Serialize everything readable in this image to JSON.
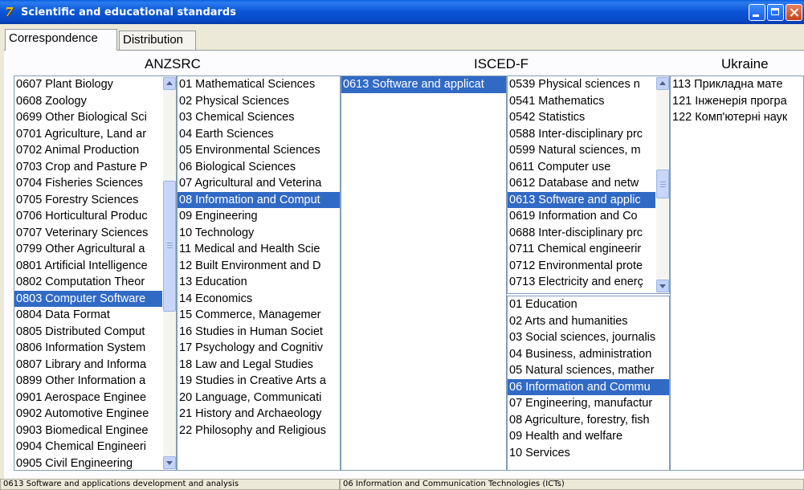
{
  "window": {
    "title": "Scientific and educational standards",
    "icon": "app-logo-icon"
  },
  "tabs": [
    {
      "label": "Correspondence"
    },
    {
      "label": "Distribution"
    }
  ],
  "headers": {
    "anzsrc": "ANZSRC",
    "isced": "ISCED-F",
    "ukraine": "Ukraine"
  },
  "anzsrc_fields": [
    {
      "label": "0607 Plant Biology",
      "selected": false
    },
    {
      "label": "0608 Zoology",
      "selected": false
    },
    {
      "label": "0699 Other Biological Sci",
      "selected": false
    },
    {
      "label": "0701 Agriculture, Land ar",
      "selected": false
    },
    {
      "label": "0702 Animal Production",
      "selected": false
    },
    {
      "label": "0703 Crop and Pasture P",
      "selected": false
    },
    {
      "label": "0704 Fisheries Sciences",
      "selected": false
    },
    {
      "label": "0705 Forestry Sciences",
      "selected": false
    },
    {
      "label": "0706 Horticultural Produc",
      "selected": false
    },
    {
      "label": "0707 Veterinary Sciences",
      "selected": false
    },
    {
      "label": "0799 Other Agricultural a",
      "selected": false
    },
    {
      "label": "0801 Artificial Intelligence",
      "selected": false
    },
    {
      "label": "0802 Computation Theor",
      "selected": false
    },
    {
      "label": "0803 Computer Software",
      "selected": true
    },
    {
      "label": "0804 Data Format",
      "selected": false
    },
    {
      "label": "0805 Distributed Comput",
      "selected": false
    },
    {
      "label": "0806 Information System",
      "selected": false
    },
    {
      "label": "0807 Library and Informa",
      "selected": false
    },
    {
      "label": "0899 Other Information a",
      "selected": false
    },
    {
      "label": "0901 Aerospace Enginee",
      "selected": false
    },
    {
      "label": "0902 Automotive Enginee",
      "selected": false
    },
    {
      "label": "0903 Biomedical Enginee",
      "selected": false
    },
    {
      "label": "0904 Chemical Engineeri",
      "selected": false
    },
    {
      "label": "0905 Civil Engineering",
      "selected": false
    }
  ],
  "anzsrc_divisions": [
    {
      "label": "01 Mathematical Sciences",
      "selected": false
    },
    {
      "label": "02 Physical Sciences",
      "selected": false
    },
    {
      "label": "03 Chemical Sciences",
      "selected": false
    },
    {
      "label": "04 Earth Sciences",
      "selected": false
    },
    {
      "label": "05 Environmental Sciences",
      "selected": false
    },
    {
      "label": "06 Biological Sciences",
      "selected": false
    },
    {
      "label": "07 Agricultural and Veterina",
      "selected": false
    },
    {
      "label": "08 Information and Comput",
      "selected": true
    },
    {
      "label": "09 Engineering",
      "selected": false
    },
    {
      "label": "10 Technology",
      "selected": false
    },
    {
      "label": "11 Medical and Health Scie",
      "selected": false
    },
    {
      "label": "12 Built Environment and D",
      "selected": false
    },
    {
      "label": "13 Education",
      "selected": false
    },
    {
      "label": "14 Economics",
      "selected": false
    },
    {
      "label": "15 Commerce, Managemer",
      "selected": false
    },
    {
      "label": "16 Studies in Human Societ",
      "selected": false
    },
    {
      "label": "17 Psychology and Cognitiv",
      "selected": false
    },
    {
      "label": "18 Law and Legal Studies",
      "selected": false
    },
    {
      "label": "19 Studies in Creative Arts a",
      "selected": false
    },
    {
      "label": "20 Language, Communicati",
      "selected": false
    },
    {
      "label": "21 History and Archaeology",
      "selected": false
    },
    {
      "label": "22 Philosophy and Religious",
      "selected": false
    }
  ],
  "correspondence": [
    {
      "label": "0613 Software and applicat",
      "selected": true
    }
  ],
  "isced_detailed": [
    {
      "label": "0539 Physical sciences n",
      "selected": false
    },
    {
      "label": "0541 Mathematics",
      "selected": false
    },
    {
      "label": "0542 Statistics",
      "selected": false
    },
    {
      "label": "0588 Inter-disciplinary prc",
      "selected": false
    },
    {
      "label": "0599 Natural sciences, m",
      "selected": false
    },
    {
      "label": "0611 Computer use",
      "selected": false
    },
    {
      "label": "0612 Database and netw",
      "selected": false
    },
    {
      "label": "0613 Software and applic",
      "selected": true
    },
    {
      "label": "0619 Information and Co",
      "selected": false
    },
    {
      "label": "0688 Inter-disciplinary prc",
      "selected": false
    },
    {
      "label": "0711 Chemical engineerir",
      "selected": false
    },
    {
      "label": "0712 Environmental prote",
      "selected": false
    },
    {
      "label": "0713 Electricity and enerç",
      "selected": false
    }
  ],
  "isced_broad": [
    {
      "label": "01 Education",
      "selected": false
    },
    {
      "label": "02 Arts and humanities",
      "selected": false
    },
    {
      "label": "03 Social sciences, journalis",
      "selected": false
    },
    {
      "label": "04 Business, administration",
      "selected": false
    },
    {
      "label": "05 Natural sciences, mather",
      "selected": false
    },
    {
      "label": "06 Information and Commu",
      "selected": true
    },
    {
      "label": "07 Engineering, manufactur",
      "selected": false
    },
    {
      "label": "08 Agriculture, forestry, fish",
      "selected": false
    },
    {
      "label": "09 Health and welfare",
      "selected": false
    },
    {
      "label": "10 Services",
      "selected": false
    }
  ],
  "ukraine": [
    {
      "label": "113 Прикладна мате",
      "selected": false
    },
    {
      "label": "121 Інженерія програ",
      "selected": false
    },
    {
      "label": "122 Комп'ютерні наук",
      "selected": false
    }
  ],
  "status": {
    "left": "0613 Software and applications development and analysis",
    "right": "06 Information and Communication Technologies (ICTs)"
  },
  "colors": {
    "selection": "#316ac5",
    "titlebar": "#0b58d8",
    "border": "#7f9db9"
  }
}
